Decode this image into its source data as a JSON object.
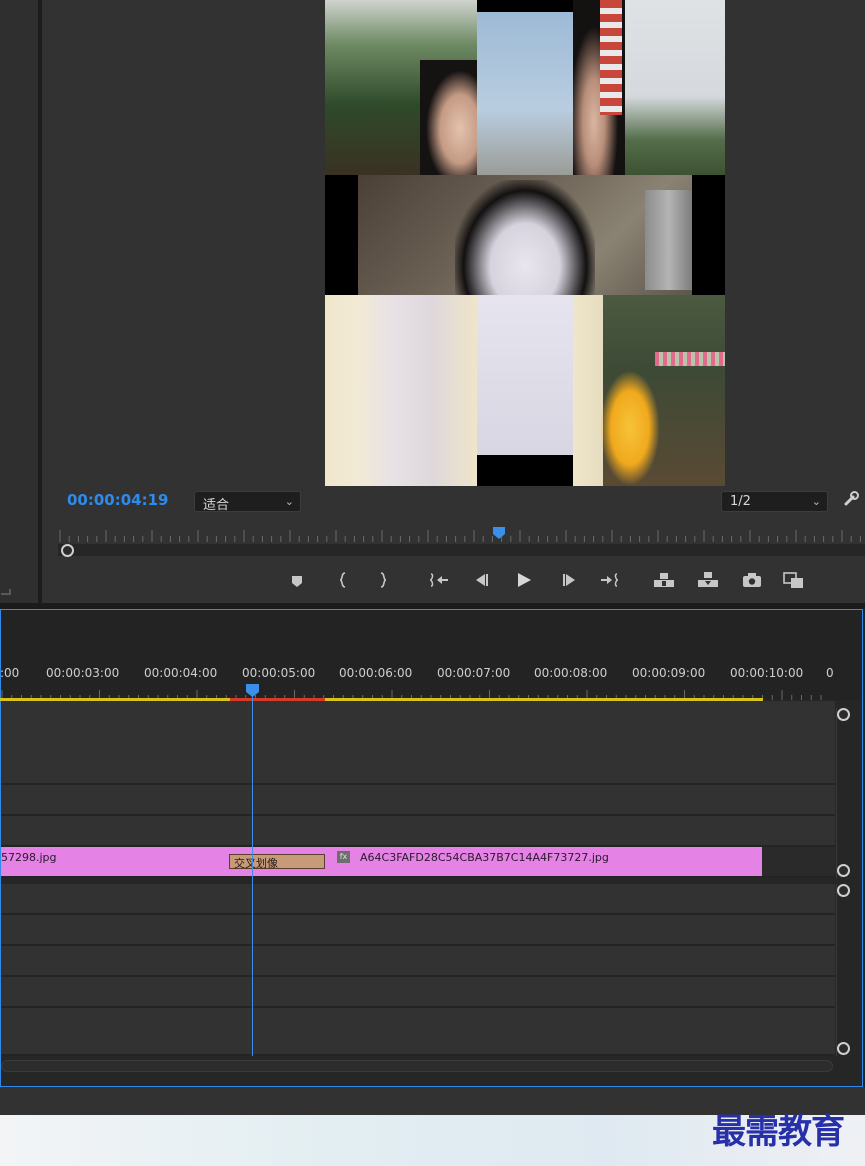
{
  "monitor": {
    "timecode": "00:00:04:19",
    "zoom": {
      "value": "适合"
    },
    "resolution": {
      "value": "1/2"
    }
  },
  "timeline": {
    "ruler_labels": [
      ":00",
      "00:00:03:00",
      "00:00:04:00",
      "00:00:05:00",
      "00:00:06:00",
      "00:00:07:00",
      "00:00:08:00",
      "00:00:09:00",
      "00:00:10:00",
      "0"
    ],
    "clip1_name": "57298.jpg",
    "clip2_name": "A64C3FAFD28C54CBA37B7C14A4F73727.jpg",
    "transition_label": "交叉划像",
    "fx_label": "fx"
  },
  "watermark": "最需教育",
  "colors": {
    "accent": "#2d8ceb",
    "clip": "#e582e5",
    "work_area": "#d6c31e",
    "render_red": "#d73a28"
  }
}
